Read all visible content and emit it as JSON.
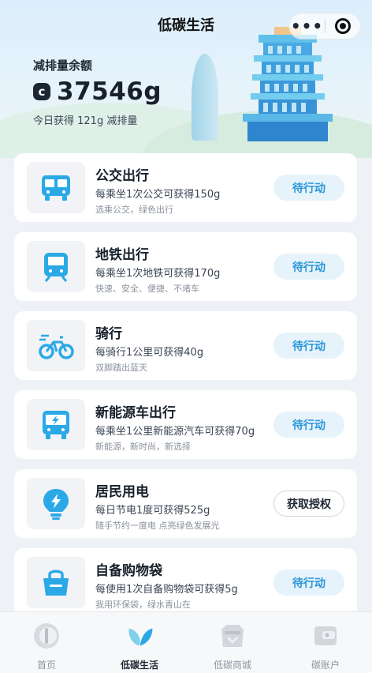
{
  "header": {
    "title": "低碳生活",
    "more_glyph": "•••"
  },
  "balance": {
    "label": "减排量余额",
    "icon_letter": "c",
    "value": "37546g",
    "today": "今日获得 121g 减排量"
  },
  "cards": [
    {
      "title": "公交出行",
      "desc": "每乘坐1次公交可获得150g",
      "sub": "选乘公交，绿色出行",
      "action": "待行动",
      "icon": "bus-icon"
    },
    {
      "title": "地铁出行",
      "desc": "每乘坐1次地铁可获得170g",
      "sub": "快速、安全、便捷、不堵车",
      "action": "待行动",
      "icon": "metro-icon"
    },
    {
      "title": "骑行",
      "desc": "每骑行1公里可获得40g",
      "sub": "双脚踏出蓝天",
      "action": "待行动",
      "icon": "bicycle-icon"
    },
    {
      "title": "新能源车出行",
      "desc": "每乘坐1公里新能源汽车可获得70g",
      "sub": "新能源，新时尚，新选择",
      "action": "待行动",
      "icon": "ev-bus-icon"
    },
    {
      "title": "居民用电",
      "desc": "每日节电1度可获得525g",
      "sub": "随手节约一度电 点亮绿色发展光",
      "action": "获取授权",
      "icon": "lightning-bulb-icon"
    },
    {
      "title": "自备购物袋",
      "desc": "每使用1次自备购物袋可获得5g",
      "sub": "我用环保袋，绿水青山在",
      "action": "待行动",
      "icon": "shopping-bag-icon"
    }
  ],
  "tabs": [
    {
      "label": "首页",
      "icon": "home-icon",
      "active": false
    },
    {
      "label": "低碳生活",
      "icon": "leaf-icon",
      "active": true
    },
    {
      "label": "低碳商城",
      "icon": "mall-icon",
      "active": false
    },
    {
      "label": "碳账户",
      "icon": "wallet-icon",
      "active": false
    }
  ],
  "colors": {
    "accent": "#2897d9",
    "icon_blue": "#2aa9e6",
    "button_bg": "#e7f3fb"
  }
}
